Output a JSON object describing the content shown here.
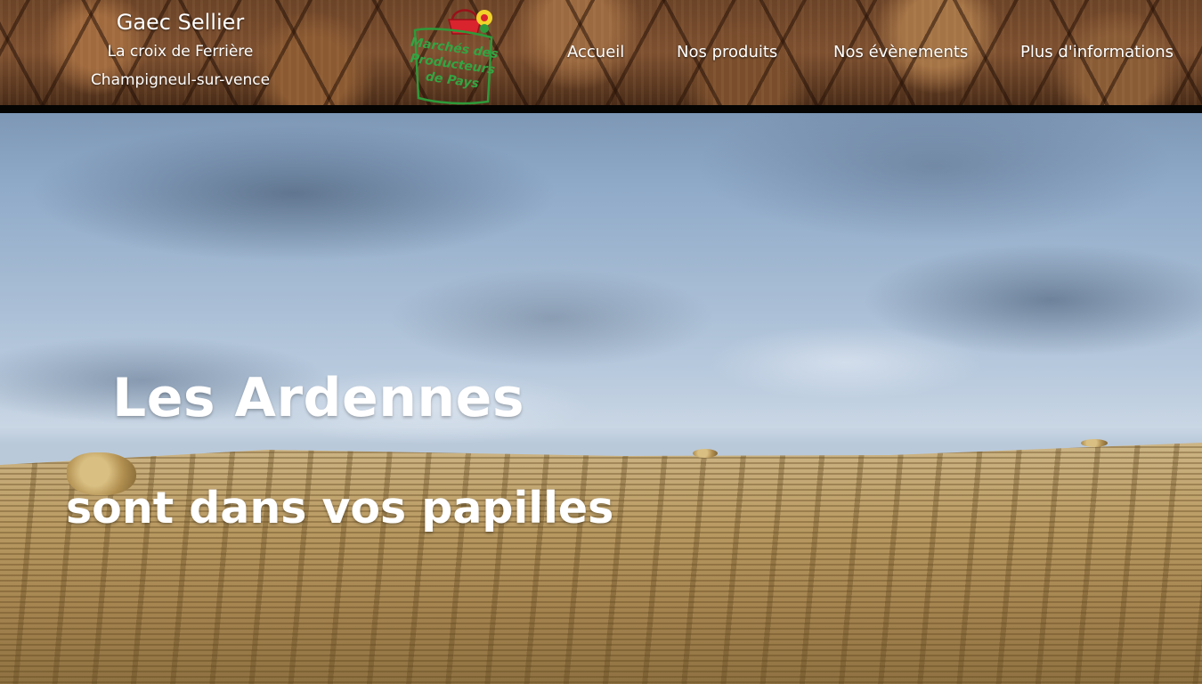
{
  "header": {
    "farm": {
      "name": "Gaec Sellier",
      "address_line": "La croix de Ferrière",
      "town": "Champigneul-sur-vence"
    },
    "logo": {
      "text_lines": [
        "Marchés des",
        "Producteurs",
        "de Pays"
      ],
      "brand_color": "#2e9a3a",
      "basket_color": "#d9232d",
      "flower_color": "#f1d32a"
    },
    "nav": [
      {
        "label": "Accueil"
      },
      {
        "label": "Nos produits"
      },
      {
        "label": "Nos évènements"
      },
      {
        "label": "Plus d'informations"
      }
    ]
  },
  "hero": {
    "title": "Les Ardennes",
    "subtitle": "sont dans vos papilles"
  }
}
